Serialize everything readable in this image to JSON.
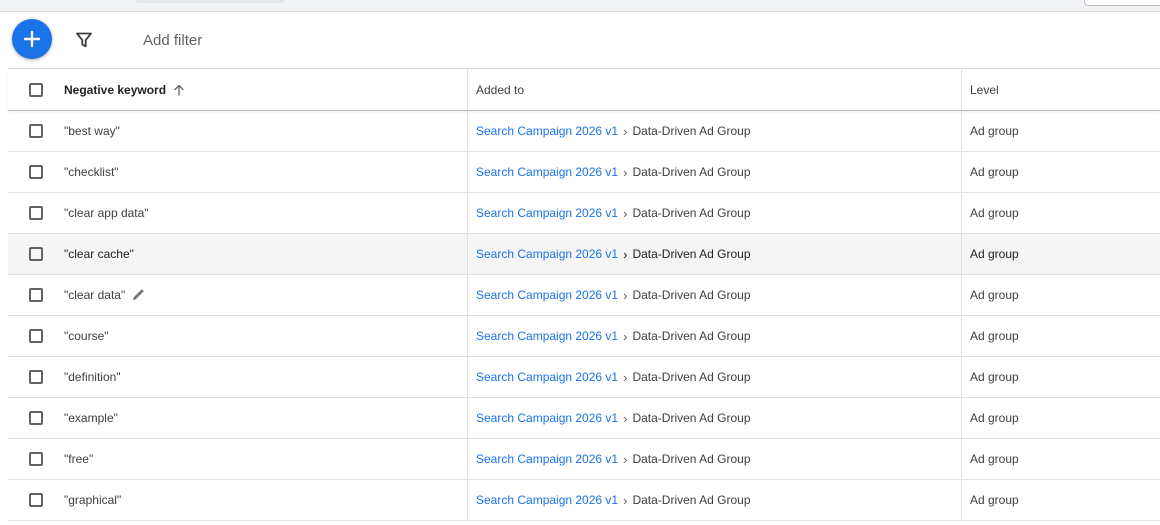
{
  "toolbar": {
    "add_filter_label": "Add filter"
  },
  "icons": {
    "fab": "plus-icon",
    "filter": "filter-icon",
    "sort": "arrow-up-icon",
    "edit": "pencil-icon"
  },
  "colors": {
    "accent": "#1a73e8",
    "row_hover": "#f5f5f5"
  },
  "table": {
    "headers": {
      "keyword": "Negative keyword",
      "added_to": "Added to",
      "level": "Level"
    },
    "rows": [
      {
        "keyword": "\"best way\"",
        "campaign": "Search Campaign 2026 v1",
        "separator": "›",
        "ad_group": "Data-Driven Ad Group",
        "level": "Ad group"
      },
      {
        "keyword": "\"checklist\"",
        "campaign": "Search Campaign 2026 v1",
        "separator": "›",
        "ad_group": "Data-Driven Ad Group",
        "level": "Ad group"
      },
      {
        "keyword": "\"clear app data\"",
        "campaign": "Search Campaign 2026 v1",
        "separator": "›",
        "ad_group": "Data-Driven Ad Group",
        "level": "Ad group"
      },
      {
        "keyword": "\"clear cache\"",
        "campaign": "Search Campaign 2026 v1",
        "separator": "›",
        "ad_group": "Data-Driven Ad Group",
        "level": "Ad group"
      },
      {
        "keyword": "\"clear data\"",
        "campaign": "Search Campaign 2026 v1",
        "separator": "›",
        "ad_group": "Data-Driven Ad Group",
        "level": "Ad group"
      },
      {
        "keyword": "\"course\"",
        "campaign": "Search Campaign 2026 v1",
        "separator": "›",
        "ad_group": "Data-Driven Ad Group",
        "level": "Ad group"
      },
      {
        "keyword": "\"definition\"",
        "campaign": "Search Campaign 2026 v1",
        "separator": "›",
        "ad_group": "Data-Driven Ad Group",
        "level": "Ad group"
      },
      {
        "keyword": "\"example\"",
        "campaign": "Search Campaign 2026 v1",
        "separator": "›",
        "ad_group": "Data-Driven Ad Group",
        "level": "Ad group"
      },
      {
        "keyword": "\"free\"",
        "campaign": "Search Campaign 2026 v1",
        "separator": "›",
        "ad_group": "Data-Driven Ad Group",
        "level": "Ad group"
      },
      {
        "keyword": "\"graphical\"",
        "campaign": "Search Campaign 2026 v1",
        "separator": "›",
        "ad_group": "Data-Driven Ad Group",
        "level": "Ad group"
      }
    ]
  }
}
